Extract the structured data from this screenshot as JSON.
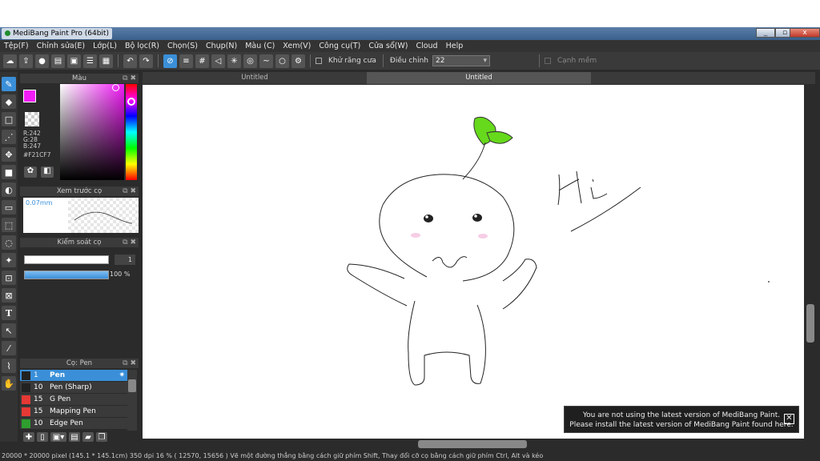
{
  "window": {
    "title": "MediBang Paint Pro (64bit)",
    "controls": [
      "_",
      "▫",
      "x"
    ]
  },
  "menu": [
    "Tệp(F)",
    "Chỉnh sửa(E)",
    "Lớp(L)",
    "Bộ lọc(R)",
    "Chọn(S)",
    "Chụp(N)",
    "Màu (C)",
    "Xem(V)",
    "Công cụ(T)",
    "Cửa sổ(W)",
    "Cloud",
    "Help"
  ],
  "toolbar": {
    "antialias_label": "Khử răng cưa",
    "adjust_label": "Điều chỉnh",
    "adjust_value": "22",
    "soft_edge_label": "Cạnh mềm"
  },
  "color_panel": {
    "title": "Màu",
    "r": "R:242",
    "g": "G:28",
    "b": "B:247",
    "hex": "#F21CF7",
    "current_color": "#f21cf7"
  },
  "brush_preview": {
    "title": "Xem trước cọ",
    "size": "0.07mm"
  },
  "brush_control": {
    "title": "Kiểm soát cọ",
    "size_value": "1",
    "opacity_value": "100 %"
  },
  "brush_list": {
    "title": "Cọ: Pen",
    "items": [
      {
        "size": "1",
        "name": "Pen",
        "color": "#222222"
      },
      {
        "size": "10",
        "name": "Pen (Sharp)",
        "color": "#222222"
      },
      {
        "size": "15",
        "name": "G Pen",
        "color": "#e53935"
      },
      {
        "size": "15",
        "name": "Mapping Pen",
        "color": "#e53935"
      },
      {
        "size": "10",
        "name": "Edge Pen",
        "color": "#2e9e2e"
      }
    ]
  },
  "tabs": [
    "Untitled",
    "Untitled"
  ],
  "notification": {
    "line1": "You are not using the latest version of MediBang Paint.",
    "line2": "Please install the latest version of MediBang Paint found here."
  },
  "status": "20000 * 20000 pixel  (145.1 * 145.1cm)  350 dpi  16 %  ( 12570, 15656 )  Vẽ một đường thẳng bằng cách giữ phím Shift, Thay đổi cỡ cọ bằng cách giữ phím Ctrl, Alt và kéo",
  "drawing": {
    "sprout_color": "#66d91c",
    "text": "Hi"
  }
}
